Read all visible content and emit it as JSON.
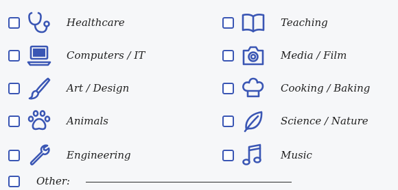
{
  "form": {
    "left_column": [
      {
        "label": "Healthcare",
        "icon": "stethoscope-icon"
      },
      {
        "label": "Computers / IT",
        "icon": "laptop-icon"
      },
      {
        "label": "Art / Design",
        "icon": "paintbrush-icon"
      },
      {
        "label": "Animals",
        "icon": "paw-icon"
      },
      {
        "label": "Engineering",
        "icon": "wrench-icon"
      }
    ],
    "right_column": [
      {
        "label": "Teaching",
        "icon": "book-icon"
      },
      {
        "label": "Media / Film",
        "icon": "camera-icon"
      },
      {
        "label": "Cooking / Baking",
        "icon": "chef-hat-icon"
      },
      {
        "label": "Science / Nature",
        "icon": "leaf-icon"
      },
      {
        "label": "Music",
        "icon": "music-note-icon"
      }
    ],
    "other_label": "Other:",
    "other_value": ""
  },
  "colors": {
    "accent": "#3a56b4",
    "background": "#f6f7f9",
    "text": "#1f1f1f"
  }
}
